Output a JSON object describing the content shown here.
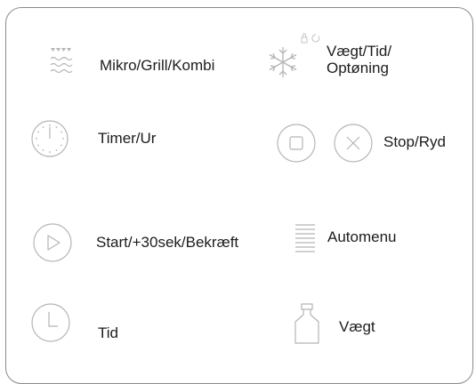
{
  "panel": {
    "buttons": {
      "mode": {
        "label": "Mikro/Grill/Kombi",
        "icon": "microwave-waves-icon"
      },
      "defrost": {
        "line1": "Vægt/Tid/",
        "line2": "Optøning",
        "icon": "snowflake-icon"
      },
      "timer": {
        "label": "Timer/Ur",
        "icon": "clock-dial-icon"
      },
      "stop": {
        "label": "Stop/Ryd",
        "icons": [
          "stop-square-icon",
          "clear-x-icon"
        ]
      },
      "start": {
        "label": "Start/+30sek/Bekræft",
        "icon": "play-icon"
      },
      "automenu": {
        "label": "Automenu",
        "icon": "menu-lines-icon"
      },
      "time": {
        "label": "Tid",
        "icon": "clock-icon"
      },
      "weight": {
        "label": "Vægt",
        "icon": "weight-icon"
      }
    }
  }
}
